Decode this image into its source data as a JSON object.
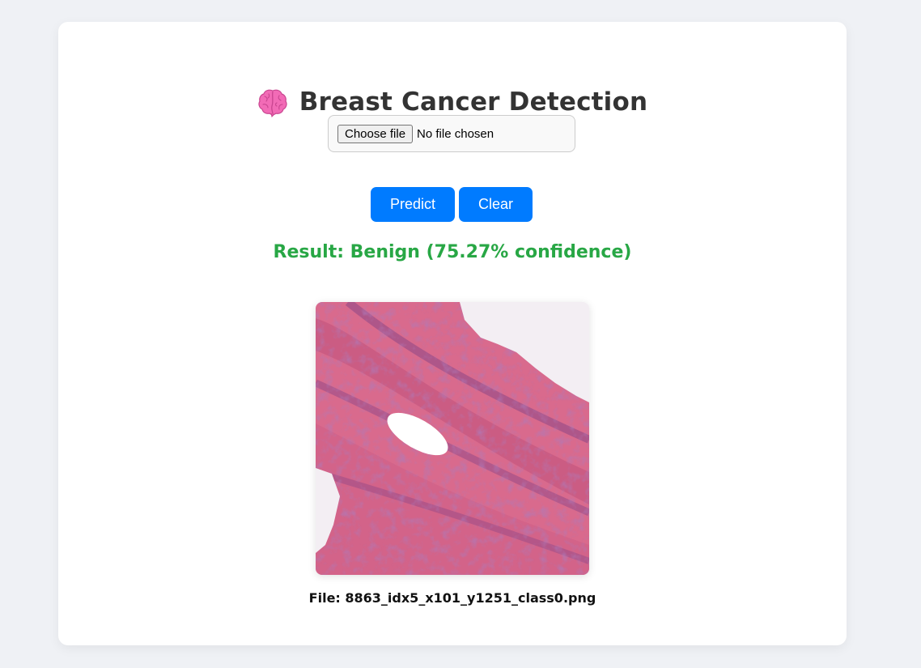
{
  "header": {
    "icon": "brain-icon",
    "title": "Breast Cancer Detection"
  },
  "upload": {
    "choose_label": "Choose file",
    "status": "No file chosen"
  },
  "actions": {
    "predict_label": "Predict",
    "clear_label": "Clear"
  },
  "result": {
    "text": "Result: Benign (75.27% confidence)",
    "color": "#28a745"
  },
  "preview": {
    "caption": "File: 8863_idx5_x101_y1251_class0.png"
  },
  "colors": {
    "accent": "#007bff",
    "title": "#333333",
    "background": "#eff1f5"
  }
}
